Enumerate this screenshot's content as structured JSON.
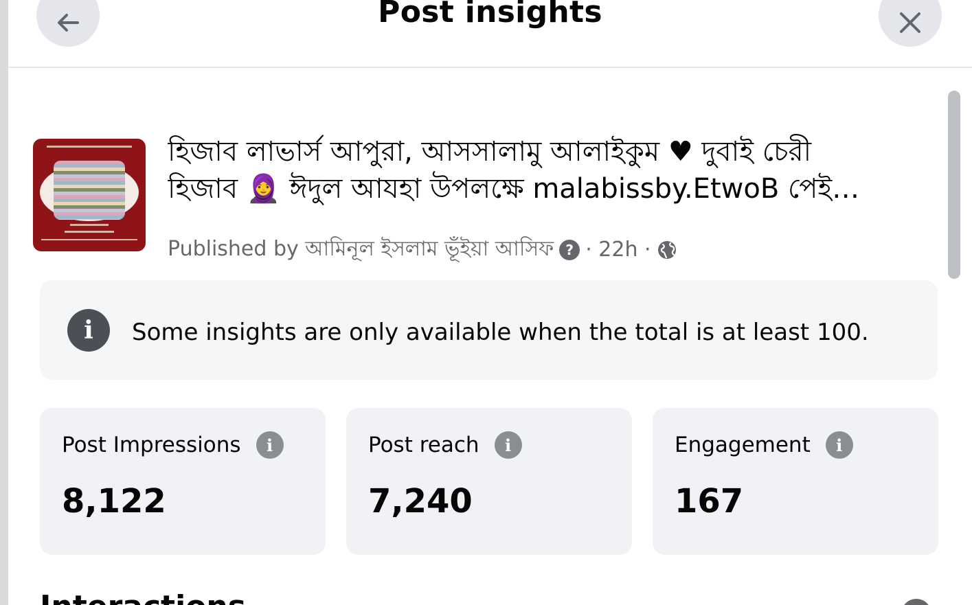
{
  "header": {
    "title": "Post insights",
    "back_icon": "arrow-left-icon",
    "close_icon": "close-icon"
  },
  "post": {
    "text_line1": "হিজাব লাভার্স আপুরা, আসসালামু আলাইকুম ♥ দুবাই চেরী",
    "text_line2": "হিজাব 🧕 ঈদুল আযহা উপলক্ষে malabissby.EtwoB পেই…",
    "published_label": "Published by আমিনূল ইসলাম ভূঁইয়া আসিফ",
    "help_icon": "?",
    "time": "· 22h ·",
    "audience_icon": "globe-icon"
  },
  "notice": {
    "text": "Some insights are only available when the total is at least 100."
  },
  "metrics": [
    {
      "label": "Post Impressions",
      "value": "8,122"
    },
    {
      "label": "Post reach",
      "value": "7,240"
    },
    {
      "label": "Engagement",
      "value": "167"
    }
  ],
  "next_section": {
    "title": "Interactions"
  },
  "colors": {
    "card_bg": "#f0f2f5",
    "notice_bg": "#f5f6f7",
    "secondary_text": "#65676b",
    "thumbnail_red": "#8e1417"
  }
}
